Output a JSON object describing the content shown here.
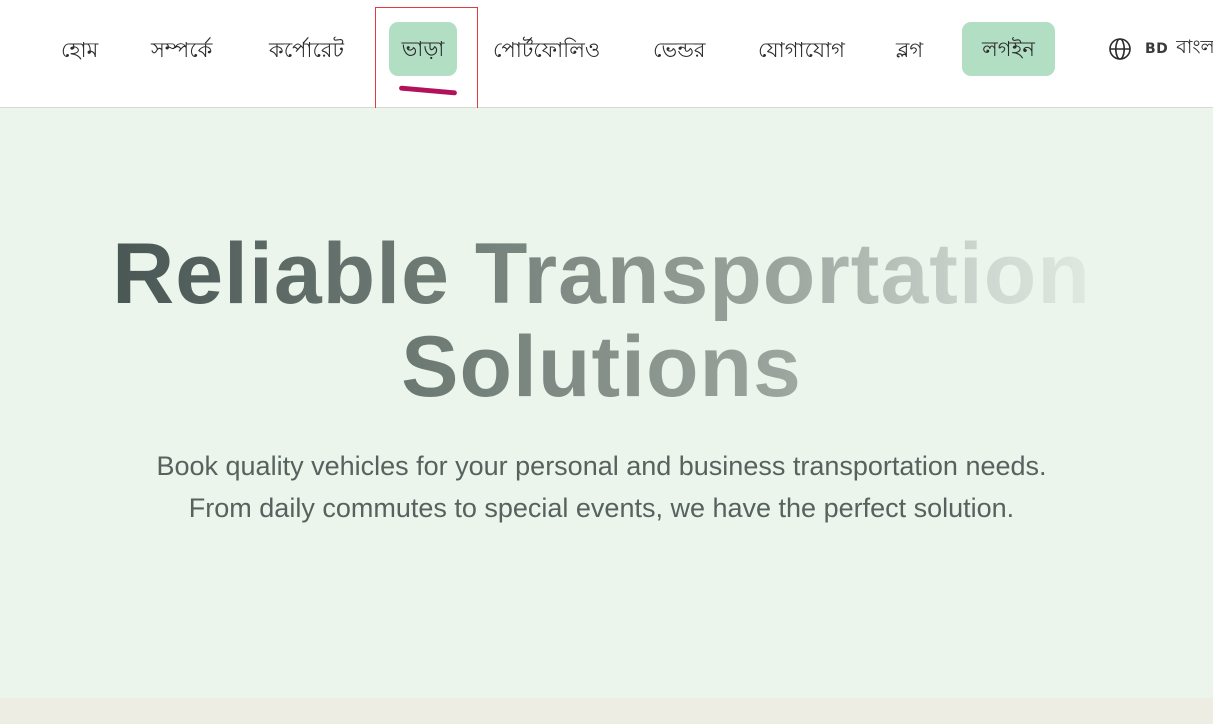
{
  "nav": {
    "items": [
      {
        "label": "হোম"
      },
      {
        "label": "সম্পর্কে"
      },
      {
        "label": "কর্পোরেট"
      },
      {
        "label": "ভাড়া"
      },
      {
        "label": "পোর্টফোলিও"
      },
      {
        "label": "ভেন্ডর"
      },
      {
        "label": "যোগাযোগ"
      },
      {
        "label": "ব্লগ"
      }
    ],
    "login_label": "লগইন",
    "language": {
      "icon": "globe-icon",
      "flag": "BD",
      "label": "বাংলা"
    }
  },
  "hero": {
    "title_line1": "Reliable Transportation",
    "title_line2": "Solutions",
    "subtitle_line1": "Book quality vehicles for your personal and business transportation needs.",
    "subtitle_line2": "From daily commutes to special events, we have the perfect solution."
  },
  "colors": {
    "accent_green": "#b2dfc4",
    "hero_background": "#ebf5ec",
    "annotation_red": "#e03c3c",
    "annotation_pen": "#b0135c"
  }
}
